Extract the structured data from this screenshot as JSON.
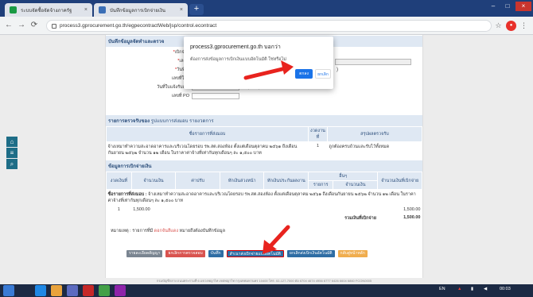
{
  "browser": {
    "tabs": [
      {
        "title": "ระบบจัดซื้อจัดจ้างภาครัฐ",
        "close": "×"
      },
      {
        "title": "บันทึกข้อมูลการเบิกจ่ายเงิน",
        "close": "×"
      }
    ],
    "new_tab": "+",
    "url": "process3.gprocurement.go.th/egpecontractWeb/jsp/control.econtract",
    "window_buttons": [
      "–",
      "□",
      "×"
    ]
  },
  "form": {
    "section_title": "บันทึกข้อมูลจัดทำและตรวจ",
    "fields": [
      {
        "label": "เบิกจ่าย"
      },
      {
        "label": "เลขท"
      },
      {
        "label": "วันที่เบิ"
      },
      {
        "label": "เลขที่ใบส"
      },
      {
        "label": "วันที่ใบแจ้งรับเงิน",
        "hint": "ระบุเป็นพุทธศักราช(ปปปป) (วว/ดด/ปปปป)"
      },
      {
        "label": "เลขที่ PO"
      }
    ],
    "field_suffix": ")"
  },
  "receipt_section": {
    "title": "รายการตรวจรับของ",
    "subtitle": "รูปแบบการส่งมอบ รายงวดการ",
    "headers": [
      "ชื่อรายการที่ส่งมอบ",
      "งวดงานที่",
      "สรุปผลตรวจรับ"
    ],
    "row": {
      "description": "จ้างเหมาทำความสะอาดอาคารและบริเวณโดยรอบ รพ.สต.สองห้อง ตั้งแต่เดือนตุลาคม ๒๕๖๑ ถึงเดือนกันยายน ๒๕๖๒ จำนวน ๑๒ เดือน ในราคาค่าจ้างที่เท่ากันทุกเดือนๆ ละ ๑,๕๐๐ บาท",
      "period": "1",
      "result": "ถูกต้องครบถ้วนและรับไว้ทั้งหมด"
    }
  },
  "payment_section": {
    "title": "ข้อมูลการเบิกจ่ายเงิน",
    "headers": [
      "งวดเงินที่",
      "จำนวนเงิน",
      "ค่าปรับ",
      "หักเงินล่วงหน้า",
      "หักเงินประกันผลงาน",
      "อื่นๆ",
      "จำนวนเงินที่เบิกจ่าย"
    ],
    "subheaders": [
      "รายการ",
      "จำนวนเงิน"
    ],
    "item_label": "ชื่อรายการที่ส่งมอบ :",
    "item_text": "จ้างเหมาทำความสะอาดอาคารและบริเวณโดยรอบ รพ.สต.สองห้อง ตั้งแต่เดือนตุลาคม ๒๕๖๑ ถึงเดือนกันยายน ๒๕๖๒ จำนวน ๑๒ เดือน ในราคาค่าจ้างที่เท่ากันทุกเดือนๆ ละ ๑,๕๐๐ บาท",
    "row": {
      "no": "1",
      "amount": "1,500.00",
      "net": "1,500.00"
    },
    "total_label": "รวมเงินที่เบิกจ่าย",
    "total_value": "1,500.00"
  },
  "note": {
    "prefix": "หมายเหตุ : รายการที่มี",
    "red": "ดอกจันสีแดง",
    "suffix": "หมายถึงต้องบันทึกข้อมูล"
  },
  "buttons": [
    {
      "label": "รายละเอียดสัญญา",
      "color": "gray"
    },
    {
      "label": "ยกเลิกการตรวจสอบ",
      "color": "red"
    },
    {
      "label": "บันทึก",
      "color": "blue"
    },
    {
      "label": "สำเนาส่งเบิกจ่ายแบบอัตโนมัติ",
      "color": "blue"
    },
    {
      "label": "ยกเลิกส่งเบิกเงินอัตโนมัติ",
      "color": "blue"
    },
    {
      "label": "กลับสู่หน้าหลัก",
      "color": "orange"
    }
  ],
  "dialog": {
    "title": "process3.gprocurement.go.th บอกว่า",
    "message": "ต้องการส่งข้อมูลการเบิกเงินแบบอัตโนมัติ ใช่หรือไม่",
    "ok": "ตกลง",
    "cancel": "ยกเลิก"
  },
  "footer": "กรมบัญชีกลาง ถนนพระรามที่ 6 แขวงพญาไท เขตพญาไท กรุงเทพมหานคร 10400 โทร. 02-127-7000 ต่อ 6704 4674 4956 6777 6426 6604 6860 FCON0005",
  "taskbar": {
    "lang": "EN",
    "time": "00:03"
  },
  "colors": {
    "arrow": "#e8231e",
    "accent": "#2e6da4",
    "dialog_ok": "#1a73e8"
  }
}
